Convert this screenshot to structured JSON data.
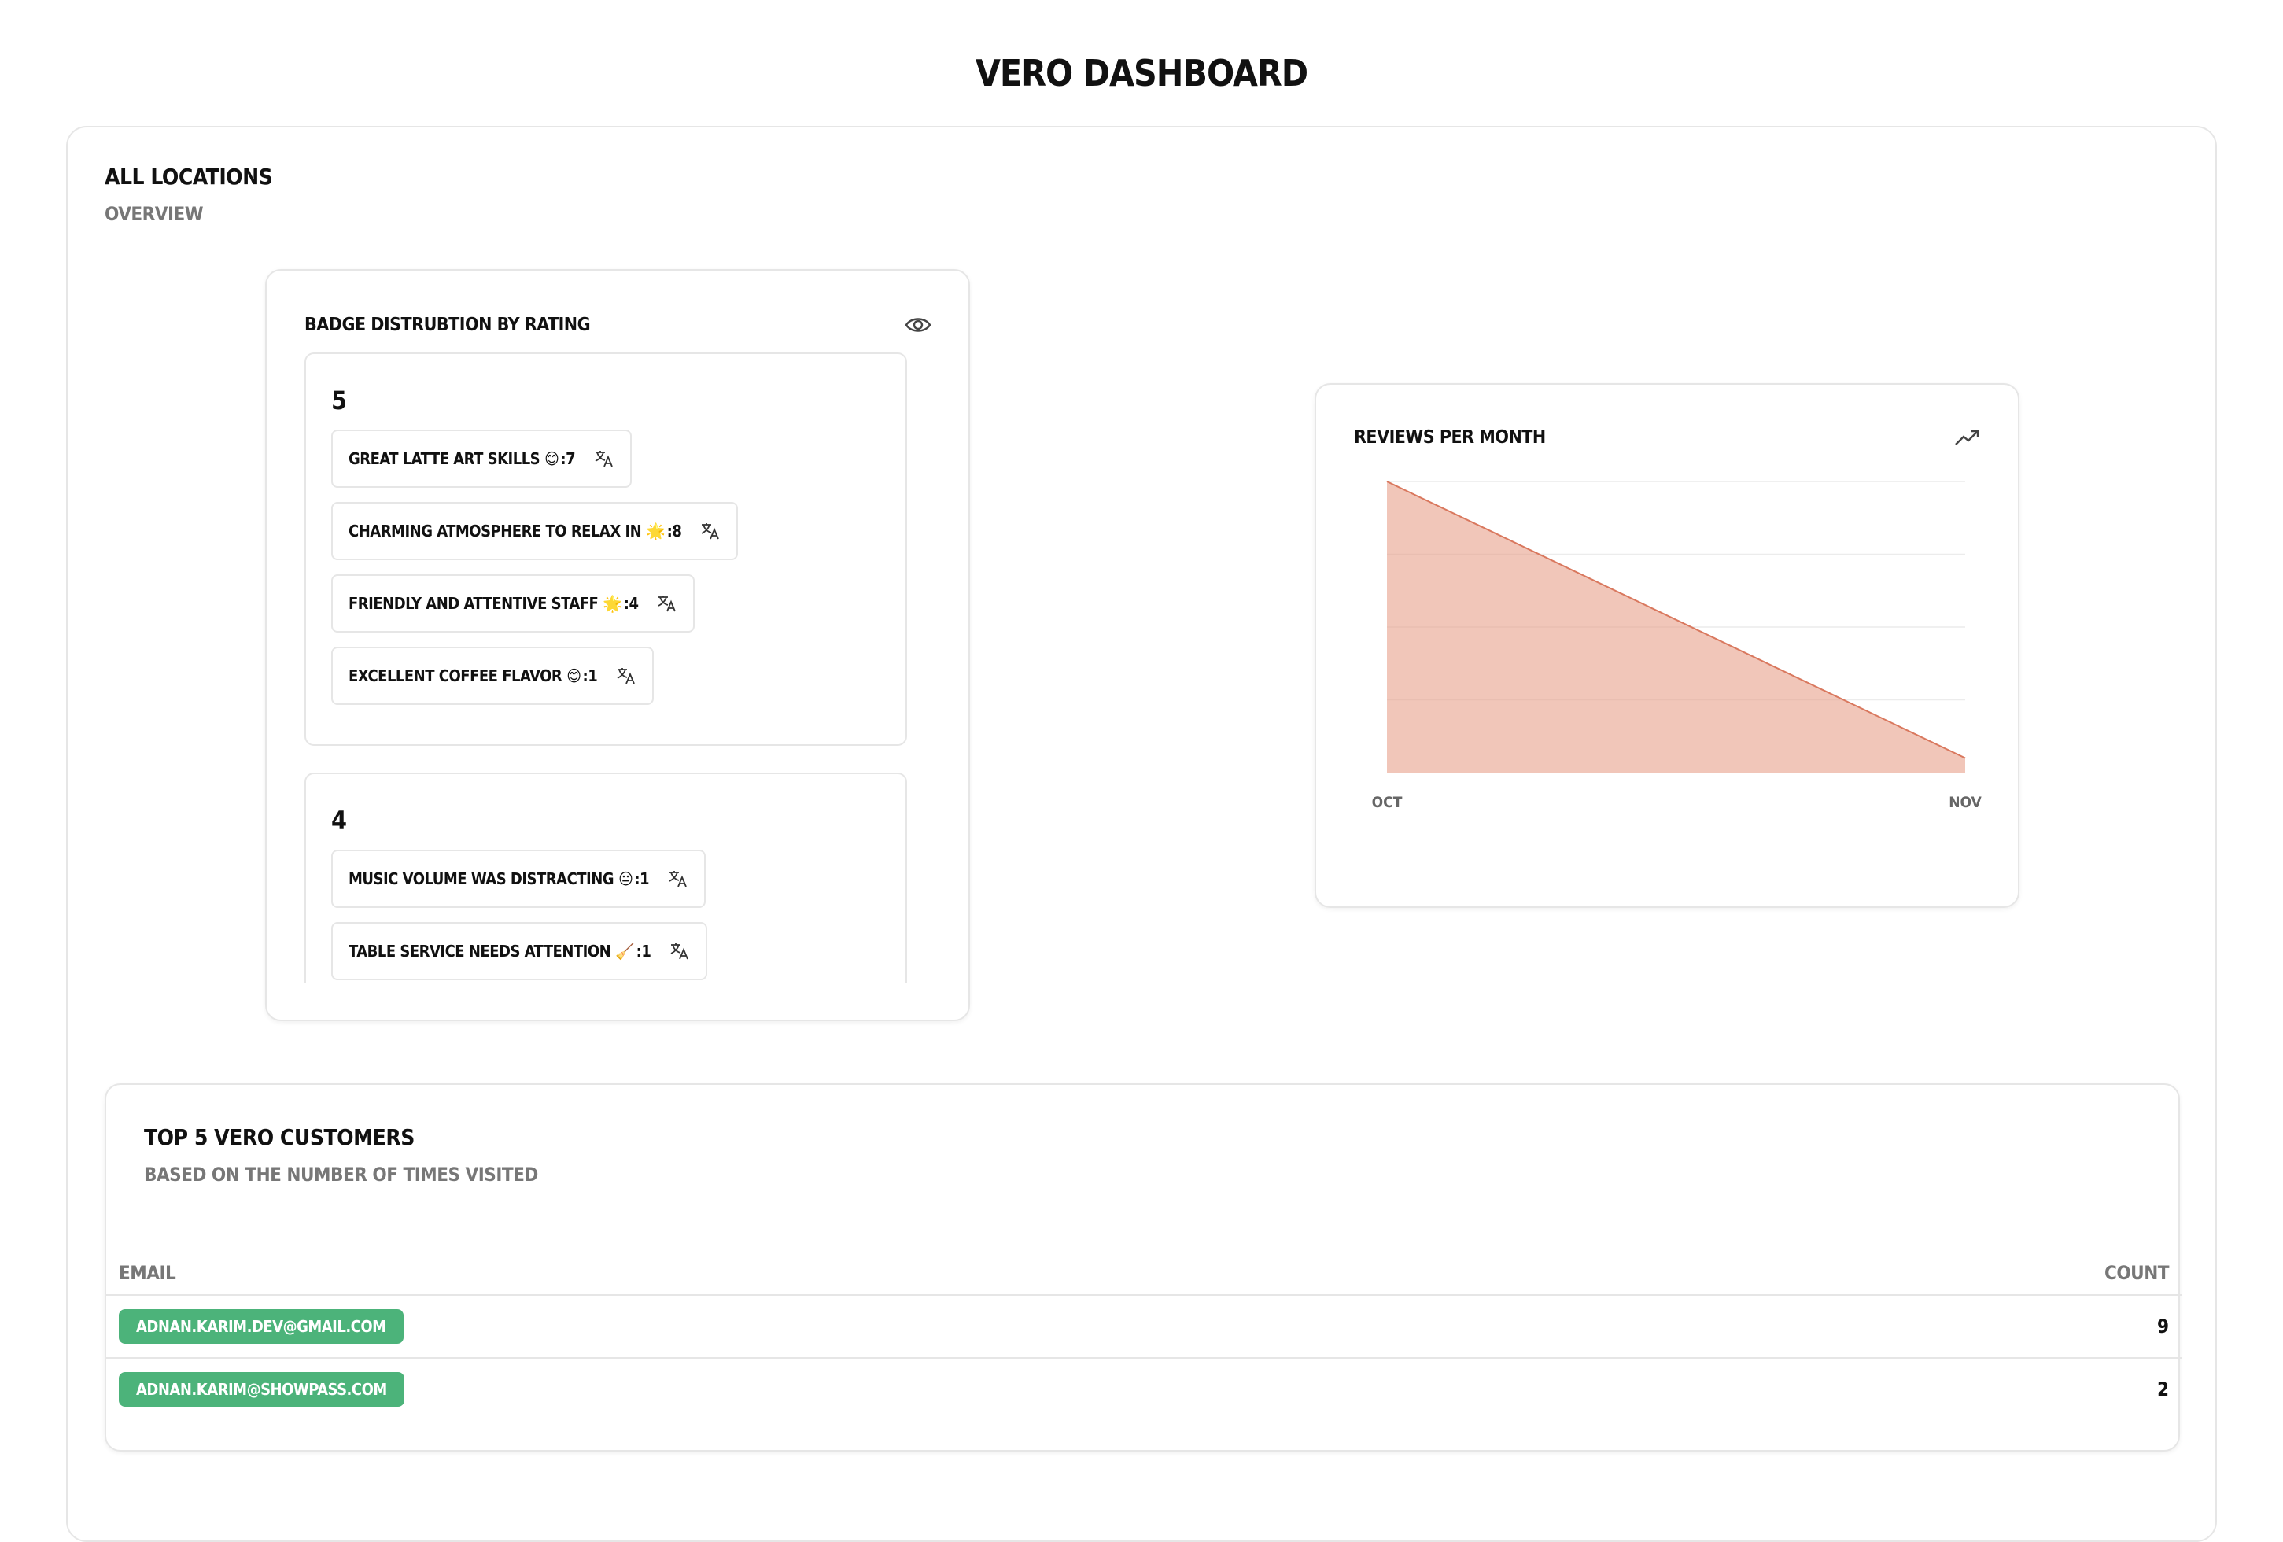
{
  "page": {
    "title": "VERO DASHBOARD"
  },
  "section": {
    "title": "ALL LOCATIONS",
    "subtitle": "OVERVIEW"
  },
  "badge_card": {
    "title": "BADGE DISTRUBTION BY RATING",
    "eye_icon": "eye-icon",
    "translate_icon": "translate-icon",
    "groups": [
      {
        "rating": "5",
        "badges": [
          {
            "label": "GREAT LATTE ART SKILLS",
            "emoji": "😊",
            "count": "7"
          },
          {
            "label": "CHARMING ATMOSPHERE TO RELAX IN",
            "emoji": "🌟",
            "count": "8"
          },
          {
            "label": "FRIENDLY AND ATTENTIVE STAFF",
            "emoji": "🌟",
            "count": "4"
          },
          {
            "label": "EXCELLENT COFFEE FLAVOR",
            "emoji": "😊",
            "count": "1"
          }
        ]
      },
      {
        "rating": "4",
        "badges": [
          {
            "label": "MUSIC VOLUME WAS DISTRACTING",
            "emoji": "😐",
            "count": "1"
          },
          {
            "label": "TABLE SERVICE NEEDS ATTENTION",
            "emoji": "🧹",
            "count": "1"
          }
        ]
      }
    ]
  },
  "reviews_card": {
    "title": "REVIEWS PER MONTH",
    "trend_icon": "trending-up-icon"
  },
  "chart_data": {
    "type": "area",
    "title": "REVIEWS PER MONTH",
    "categories": [
      "OCT",
      "NOV"
    ],
    "values": [
      20,
      1
    ],
    "ylim": [
      0,
      20
    ],
    "grid": true,
    "color": "#e8a08a",
    "line_color": "#d9785e"
  },
  "customers_card": {
    "title": "TOP 5 VERO CUSTOMERS",
    "subtitle": "BASED ON THE NUMBER OF TIMES VISITED",
    "columns": [
      "EMAIL",
      "COUNT"
    ],
    "rows": [
      {
        "email": "ADNAN.KARIM.DEV@GMAIL.COM",
        "count": "9"
      },
      {
        "email": "ADNAN.KARIM@SHOWPASS.COM",
        "count": "2"
      }
    ],
    "pill_color": "#4cb37a"
  }
}
